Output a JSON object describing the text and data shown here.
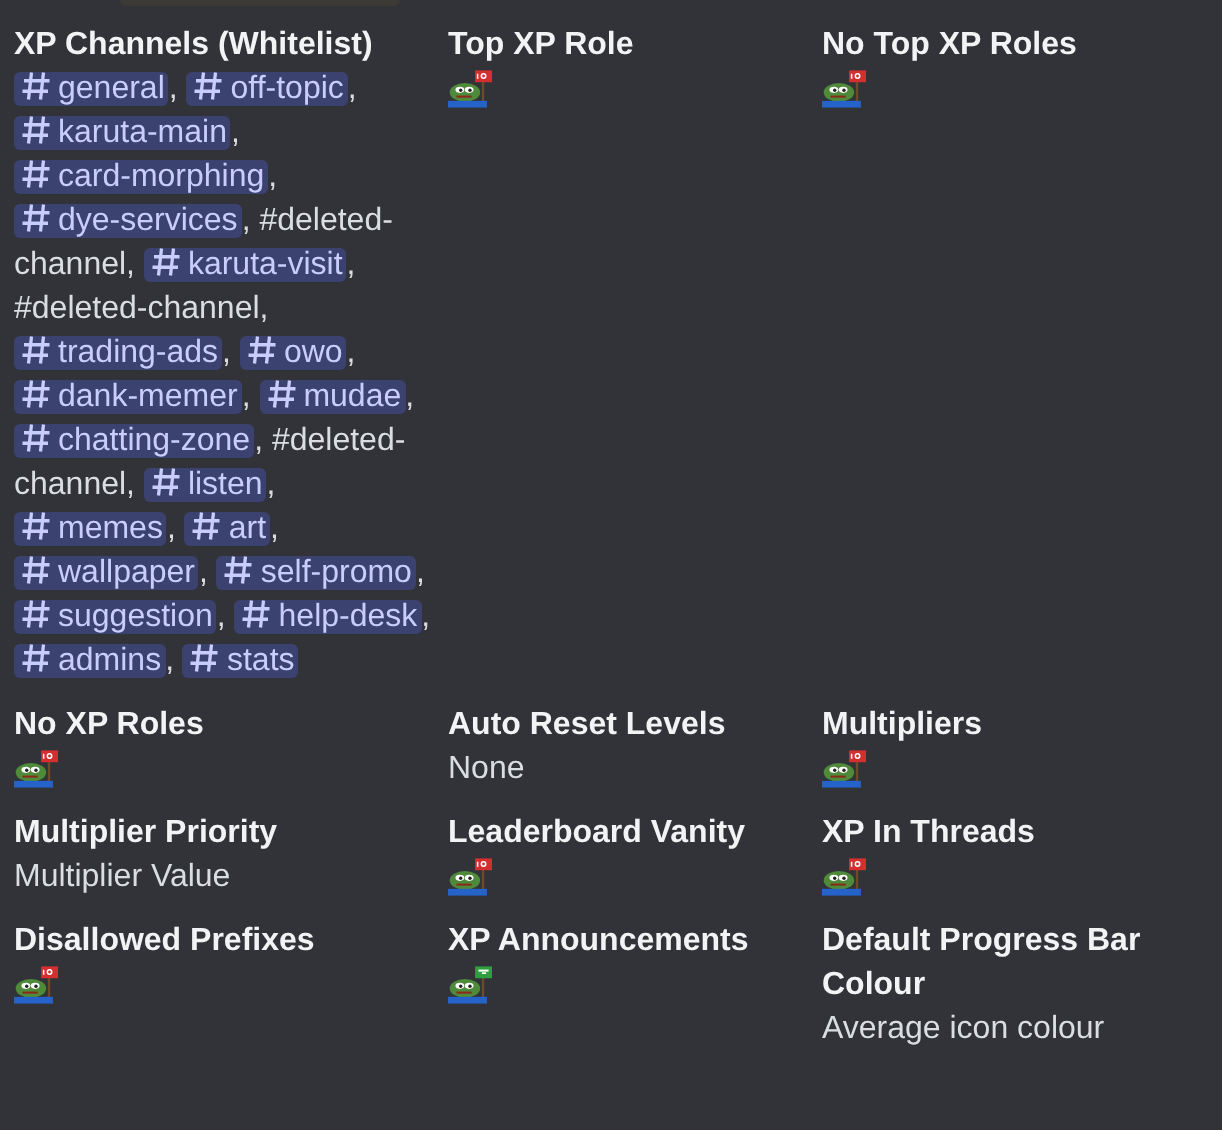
{
  "fields": [
    {
      "name": "XP Channels (Whitelist)",
      "kind": "channels",
      "segments": [
        {
          "kind": "mention",
          "text": "general"
        },
        {
          "kind": "text",
          "text": ", "
        },
        {
          "kind": "mention",
          "text": "off-topic"
        },
        {
          "kind": "text",
          "text": ", "
        },
        {
          "kind": "mention",
          "text": "karuta-main"
        },
        {
          "kind": "text",
          "text": ", "
        },
        {
          "kind": "mention",
          "text": "card-morphing"
        },
        {
          "kind": "text",
          "text": ", "
        },
        {
          "kind": "mention",
          "text": "dye-services"
        },
        {
          "kind": "text",
          "text": ", #deleted-channel, "
        },
        {
          "kind": "mention",
          "text": "karuta-visit"
        },
        {
          "kind": "text",
          "text": ", #deleted-channel, "
        },
        {
          "kind": "mention",
          "text": "trading-ads"
        },
        {
          "kind": "text",
          "text": ", "
        },
        {
          "kind": "mention",
          "text": "owo"
        },
        {
          "kind": "text",
          "text": ", "
        },
        {
          "kind": "mention",
          "text": "dank-memer"
        },
        {
          "kind": "text",
          "text": ", "
        },
        {
          "kind": "mention",
          "text": "mudae"
        },
        {
          "kind": "text",
          "text": ", "
        },
        {
          "kind": "mention",
          "text": "chatting-zone"
        },
        {
          "kind": "text",
          "text": ", #deleted-channel, "
        },
        {
          "kind": "mention",
          "text": "listen"
        },
        {
          "kind": "text",
          "text": ", "
        },
        {
          "kind": "mention",
          "text": "memes"
        },
        {
          "kind": "text",
          "text": ", "
        },
        {
          "kind": "mention",
          "text": "art"
        },
        {
          "kind": "text",
          "text": ", "
        },
        {
          "kind": "mention",
          "text": "wallpaper"
        },
        {
          "kind": "text",
          "text": ", "
        },
        {
          "kind": "mention",
          "text": "self-promo"
        },
        {
          "kind": "text",
          "text": ", "
        },
        {
          "kind": "mention",
          "text": "suggestion"
        },
        {
          "kind": "text",
          "text": ", "
        },
        {
          "kind": "mention",
          "text": "help-desk"
        },
        {
          "kind": "text",
          "text": ", "
        },
        {
          "kind": "mention",
          "text": "admins"
        },
        {
          "kind": "text",
          "text": ", "
        },
        {
          "kind": "mention",
          "text": "stats"
        }
      ]
    },
    {
      "name": "Top XP Role",
      "kind": "emoji",
      "yes": false
    },
    {
      "name": "No Top XP Roles",
      "kind": "emoji",
      "yes": false
    },
    {
      "name": "No XP Roles",
      "kind": "emoji",
      "yes": false
    },
    {
      "name": "Auto Reset Levels",
      "kind": "text",
      "value": "None"
    },
    {
      "name": "Multipliers",
      "kind": "emoji",
      "yes": false
    },
    {
      "name": "Multiplier Priority",
      "kind": "text",
      "value": "Multiplier Value"
    },
    {
      "name": "Leaderboard Vanity",
      "kind": "emoji",
      "yes": false
    },
    {
      "name": "XP In Threads",
      "kind": "emoji",
      "yes": false
    },
    {
      "name": "Disallowed Prefixes",
      "kind": "emoji",
      "yes": false
    },
    {
      "name": "XP Announcements",
      "kind": "emoji",
      "yes": true
    },
    {
      "name": "Default Progress Bar Colour",
      "kind": "text",
      "value": "Average icon colour"
    }
  ]
}
